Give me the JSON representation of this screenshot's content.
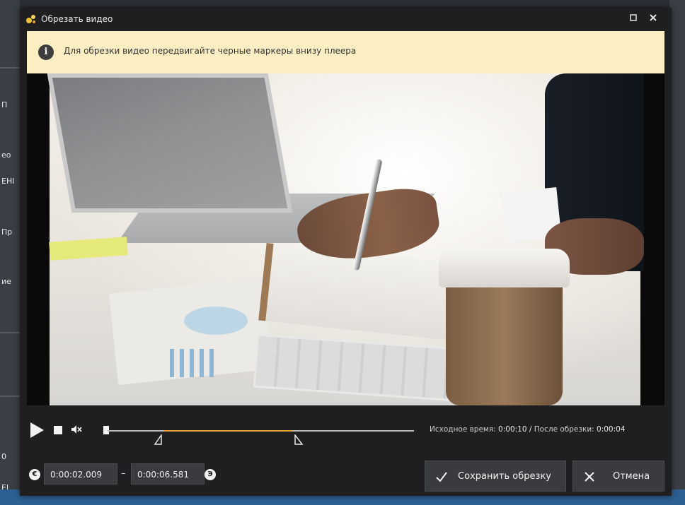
{
  "window": {
    "title": "Обрезать видео"
  },
  "background": {
    "fragments": [
      "П",
      "ео",
      "ЕНІ",
      "Пр",
      "ие",
      "0",
      "El"
    ]
  },
  "info_banner": {
    "text": "Для обрезки видео передвигайте черные маркеры внизу плеера"
  },
  "player": {
    "time_info": {
      "original_label": "Исходное время:",
      "original_value": "0:00:10",
      "separator": "/",
      "after_label": "После обрезки:",
      "after_value": "0:00:04"
    },
    "trim_start": "0:00:02.009",
    "trim_end": "0:00:06.581",
    "range_dash": "–",
    "step_left_icon_label": "€",
    "step_right_icon_label": "Э"
  },
  "buttons": {
    "save_label": "Сохранить обрезку",
    "cancel_label": "Отмена"
  },
  "colors": {
    "accent": "#e7a33e",
    "banner": "#fbeec2",
    "dialog_bg": "#1f1f21"
  }
}
